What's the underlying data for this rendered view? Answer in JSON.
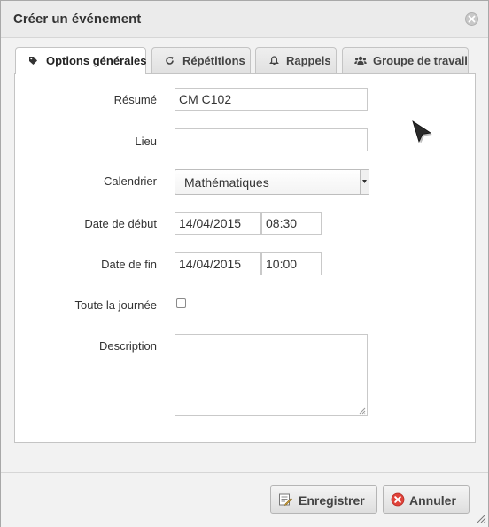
{
  "dialog": {
    "title": "Créer un événement"
  },
  "tabs": [
    {
      "label": "Options générales",
      "icon": "tag-icon",
      "active": true
    },
    {
      "label": "Répétitions",
      "icon": "refresh-icon",
      "active": false
    },
    {
      "label": "Rappels",
      "icon": "bell-icon",
      "active": false
    },
    {
      "label": "Groupe de travail",
      "icon": "users-icon",
      "active": false
    }
  ],
  "form": {
    "summary_label": "Résumé",
    "summary_value": "CM C102",
    "location_label": "Lieu",
    "location_value": "",
    "calendar_label": "Calendrier",
    "calendar_value": "Mathématiques",
    "start_label": "Date de début",
    "start_date": "14/04/2015",
    "start_time": "08:30",
    "end_label": "Date de fin",
    "end_date": "14/04/2015",
    "end_time": "10:00",
    "allday_label": "Toute la journée",
    "allday_checked": false,
    "description_label": "Description",
    "description_value": ""
  },
  "footer": {
    "save_label": "Enregistrer",
    "cancel_label": "Annuler"
  },
  "colors": {
    "cancel_icon": "#e0433a",
    "save_icon": "#d4a23a"
  }
}
